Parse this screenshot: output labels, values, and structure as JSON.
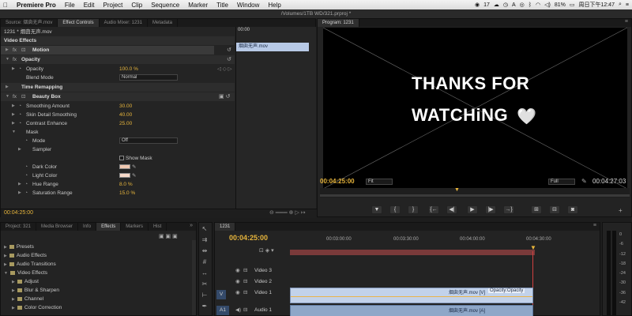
{
  "menubar": {
    "apple": "",
    "app": "Premiere Pro",
    "items": [
      "File",
      "Edit",
      "Project",
      "Clip",
      "Sequence",
      "Marker",
      "Title",
      "Window",
      "Help"
    ],
    "status": {
      "badge": "17",
      "battery": "81%",
      "clock": "周日下午12:47"
    }
  },
  "title": "/Volumes/1TB WD/321.prproj *",
  "source_tabs": [
    "Source: 烟囱无声.mov",
    "Effect Controls",
    "Audio Mixer: 1231",
    "Metadata"
  ],
  "ec": {
    "header": "1231 * 烟囱无声.mov",
    "time_label": "00:00",
    "clip_bar": "烟囱无声.mov",
    "video_effects": "Video Effects",
    "motion": "Motion",
    "opacity": "Opacity",
    "opacity_prop": "Opacity",
    "opacity_val": "100.0 %",
    "blend": "Blend Mode",
    "blend_val": "Normal",
    "time_remap": "Time Remapping",
    "beauty": "Beauty Box",
    "smoothing": "Smoothing Amount",
    "smoothing_val": "30.00",
    "skin": "Skin Detail Smoothing",
    "skin_val": "40.00",
    "contrast": "Contrast Enhance",
    "contrast_val": "25.00",
    "mask": "Mask",
    "mode": "Mode",
    "mode_val": "Off",
    "sampler": "Sampler",
    "show_mask": "Show Mask",
    "dark": "Dark Color",
    "light": "Light Color",
    "hue": "Hue Range",
    "hue_val": "8.0 %",
    "sat": "Saturation Range",
    "sat_val": "15.0 %",
    "timecode": "00:04:25:00"
  },
  "program": {
    "tab": "Program: 1231",
    "line1": "THANKS FOR",
    "line2": "WATCHiNG",
    "heart": "🤍",
    "timecode": "00:04:25:00",
    "fit": "Fit",
    "full": "Full",
    "duration": "00:04:27:03"
  },
  "project_tabs": [
    "Project: 321",
    "Media Browser",
    "Info",
    "Effects",
    "Markers",
    "Hist"
  ],
  "effects": {
    "items": [
      "Presets",
      "Audio Effects",
      "Audio Transitions",
      "Video Effects",
      "Adjust",
      "Blur & Sharpen",
      "Channel",
      "Color Correction"
    ]
  },
  "timeline": {
    "tab": "1231",
    "timecode": "00:04:25:00",
    "ruler": [
      "00:03:00:00",
      "00:03:30:00",
      "00:04:00:00",
      "00:04:30:00"
    ],
    "tracks": [
      "Video 3",
      "Video 2",
      "Video 1",
      "Audio 1"
    ],
    "v_label": "V",
    "a_label": "A1",
    "clip_v": "烟囱无声.mov [V]",
    "clip_v_fx": "Opacity:Opacity",
    "clip_a": "烟囱无声.mov [A]"
  },
  "meter": {
    "labels": [
      "0",
      "-6",
      "-12",
      "-18",
      "-24",
      "-30",
      "-36",
      "-42"
    ]
  }
}
